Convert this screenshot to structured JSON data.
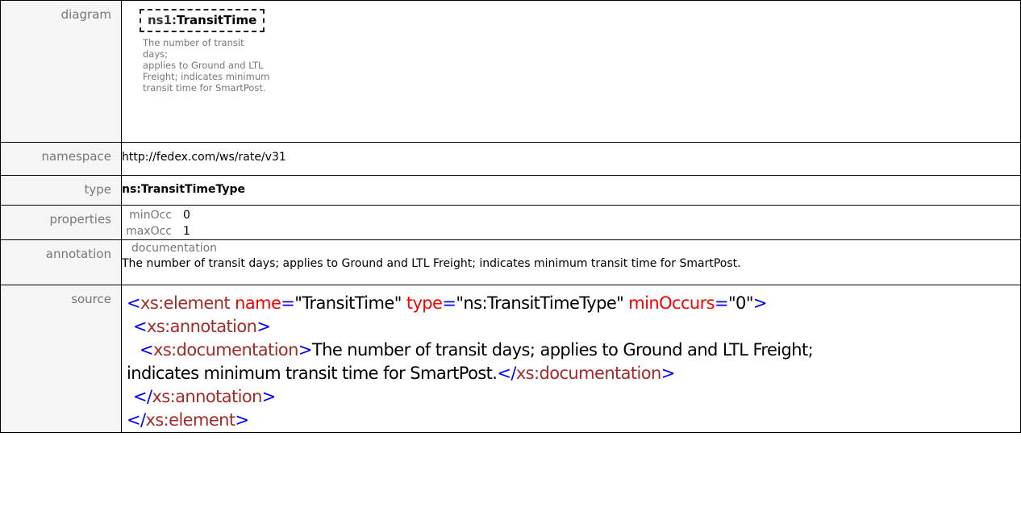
{
  "rows": {
    "diagram_label": "diagram",
    "namespace_label": "namespace",
    "type_label": "type",
    "properties_label": "properties",
    "annotation_label": "annotation",
    "source_label": "source"
  },
  "diagram": {
    "prefix": "ns1:",
    "element_name": "TransitTime",
    "doc_line1": "The number of transit days;",
    "doc_line2": "applies to Ground and LTL",
    "doc_line3": "Freight; indicates minimum",
    "doc_line4": "transit time for SmartPost."
  },
  "namespace": "http://fedex.com/ws/rate/v31",
  "type": "ns:TransitTimeType",
  "properties": {
    "min_label": "minOcc",
    "min_value": "0",
    "max_label": "maxOcc",
    "max_value": "1"
  },
  "annotation": {
    "heading": "documentation",
    "text": "The number of transit days; applies to Ground and LTL Freight; indicates minimum transit time for SmartPost."
  },
  "source": {
    "lt": "<",
    "gt": ">",
    "close_lt": "</",
    "eq": "=",
    "el_element": "xs:element",
    "el_annotation": "xs:annotation",
    "el_documentation": "xs:documentation",
    "attr_name": "name",
    "attr_name_val": "\"TransitTime\"",
    "attr_type": "type",
    "attr_type_val": "\"ns:TransitTimeType\"",
    "attr_min": "minOccurs",
    "attr_min_val": "\"0\"",
    "doc_text_a": "The number of transit days; applies to Ground and LTL Freight;",
    "doc_text_b": "indicates minimum transit time for SmartPost."
  }
}
